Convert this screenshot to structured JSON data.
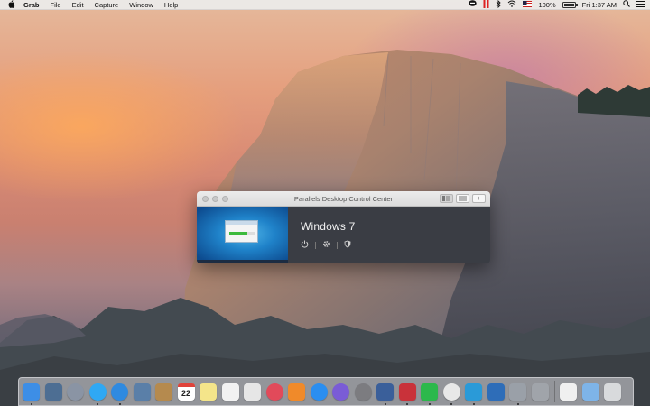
{
  "menubar": {
    "apple_icon": "apple-logo-icon",
    "app_name": "Grab",
    "menus": [
      "File",
      "Edit",
      "Capture",
      "Window",
      "Help"
    ],
    "status": {
      "battery_percent_label": "100%",
      "battery_level": 1.0,
      "clock": "Fri 1:37 AM"
    }
  },
  "window": {
    "title": "Parallels Desktop Control Center",
    "add_label": "+",
    "vm": {
      "name": "Windows 7"
    }
  },
  "dock": {
    "apps": [
      {
        "name": "finder",
        "icon": "finder-icon",
        "color": "#3d8ee6",
        "running": true
      },
      {
        "name": "photos-viewer",
        "icon": "preview-icon",
        "color": "#4d6e93",
        "running": false
      },
      {
        "name": "launchpad",
        "icon": "rocket-icon",
        "color": "#8a94a4",
        "running": false
      },
      {
        "name": "messages",
        "icon": "messages-icon",
        "color": "#2fa8f4",
        "running": true
      },
      {
        "name": "safari",
        "icon": "compass-icon",
        "color": "#2f8ae0",
        "running": true
      },
      {
        "name": "preview",
        "icon": "photo-icon",
        "color": "#5a7fa8",
        "running": false
      },
      {
        "name": "contacts",
        "icon": "contacts-icon",
        "color": "#b58a4e",
        "running": false
      },
      {
        "name": "calendar",
        "icon": "calendar-icon",
        "color": "#ffffff",
        "label": "22",
        "running": false
      },
      {
        "name": "notes",
        "icon": "notes-icon",
        "color": "#f4e58a",
        "running": false
      },
      {
        "name": "reminders",
        "icon": "reminders-icon",
        "color": "#f2f2f2",
        "running": false
      },
      {
        "name": "photos",
        "icon": "photos-icon",
        "color": "#e6e6e6",
        "running": false
      },
      {
        "name": "itunes",
        "icon": "music-icon",
        "color": "#e24a5a",
        "running": false
      },
      {
        "name": "ibooks",
        "icon": "book-icon",
        "color": "#f08a2a",
        "running": false
      },
      {
        "name": "app-store",
        "icon": "app-store-icon",
        "color": "#2a8ef0",
        "running": false
      },
      {
        "name": "ibooks-author",
        "icon": "info-icon",
        "color": "#7a5cd6",
        "running": false
      },
      {
        "name": "system-preferences",
        "icon": "gear-icon",
        "color": "#7c7c80",
        "running": false
      },
      {
        "name": "xcode",
        "icon": "hammer-icon",
        "color": "#3a5f9a",
        "running": true
      },
      {
        "name": "parallels-desktop",
        "icon": "parallels-icon",
        "color": "#c9323a",
        "running": true
      },
      {
        "name": "line",
        "icon": "line-chat-icon",
        "color": "#2cb84c",
        "running": true
      },
      {
        "name": "chrome",
        "icon": "chrome-icon",
        "color": "#e8e8e8",
        "running": true
      },
      {
        "name": "skitch",
        "icon": "skitch-icon",
        "color": "#2a9ad8",
        "running": true
      },
      {
        "name": "remote-desktop",
        "icon": "remote-desktop-icon",
        "color": "#2e6db8",
        "running": false
      },
      {
        "name": "grab",
        "icon": "grab-icon",
        "color": "#9aa0a8",
        "running": true
      },
      {
        "name": "migration",
        "icon": "migration-icon",
        "color": "#a0a4aa",
        "running": false
      }
    ],
    "stacks": [
      {
        "name": "documents",
        "icon": "document-icon",
        "color": "#f0f0f0"
      },
      {
        "name": "downloads-folder",
        "icon": "folder-icon",
        "color": "#7eb4e8"
      },
      {
        "name": "trash",
        "icon": "trash-icon",
        "color": "#d8dadc"
      }
    ]
  }
}
